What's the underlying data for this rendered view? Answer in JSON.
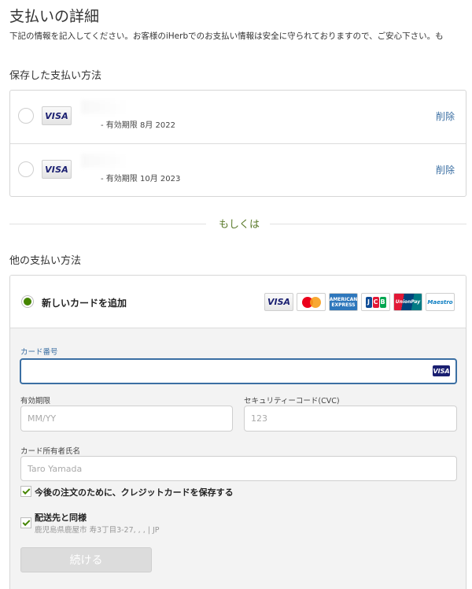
{
  "header": {
    "title": "支払いの詳細",
    "subtitle": "下記の情報を記入してください。お客様のiHerbでのお支払い情報は安全に守られておりますので、ご安心下さい。も"
  },
  "saved_methods": {
    "title": "保存した支払い方法",
    "cards": [
      {
        "brand": "VISA",
        "expiry": "- 有効期限 8月 2022",
        "delete_label": "削除"
      },
      {
        "brand": "VISA",
        "expiry": "- 有効期限 10月 2023",
        "delete_label": "削除"
      }
    ]
  },
  "divider": {
    "label": "もしくは"
  },
  "other_methods": {
    "title": "他の支払い方法",
    "new_card_label": "新しいカードを追加",
    "logos": {
      "visa": "VISA",
      "amex": "AMERICAN EXPRESS",
      "union": "UnionPay",
      "maestro": "Maestro"
    }
  },
  "form": {
    "card_number_label": "カード番号",
    "card_number_value": "",
    "card_icon": "VISA",
    "expiry_label": "有効期限",
    "expiry_placeholder": "MM/YY",
    "cvc_label": "セキュリティーコード(CVC)",
    "cvc_placeholder": "123",
    "name_label": "カード所有者氏名",
    "name_placeholder": "Taro Yamada",
    "save_card_label": "今後の注文のために、クレジットカードを保存する",
    "save_card_checked": true,
    "same_as_shipping_label": "配送先と同様",
    "same_as_shipping_checked": true,
    "address": "鹿児島県鹿屋市 寿3丁目3-27, , , | JP",
    "continue_label": "続ける"
  },
  "colors": {
    "accent_green": "#458500",
    "link_blue": "#3b6fa3",
    "focus_blue": "#3b6fa3",
    "divider_text": "#5a7a2a"
  }
}
